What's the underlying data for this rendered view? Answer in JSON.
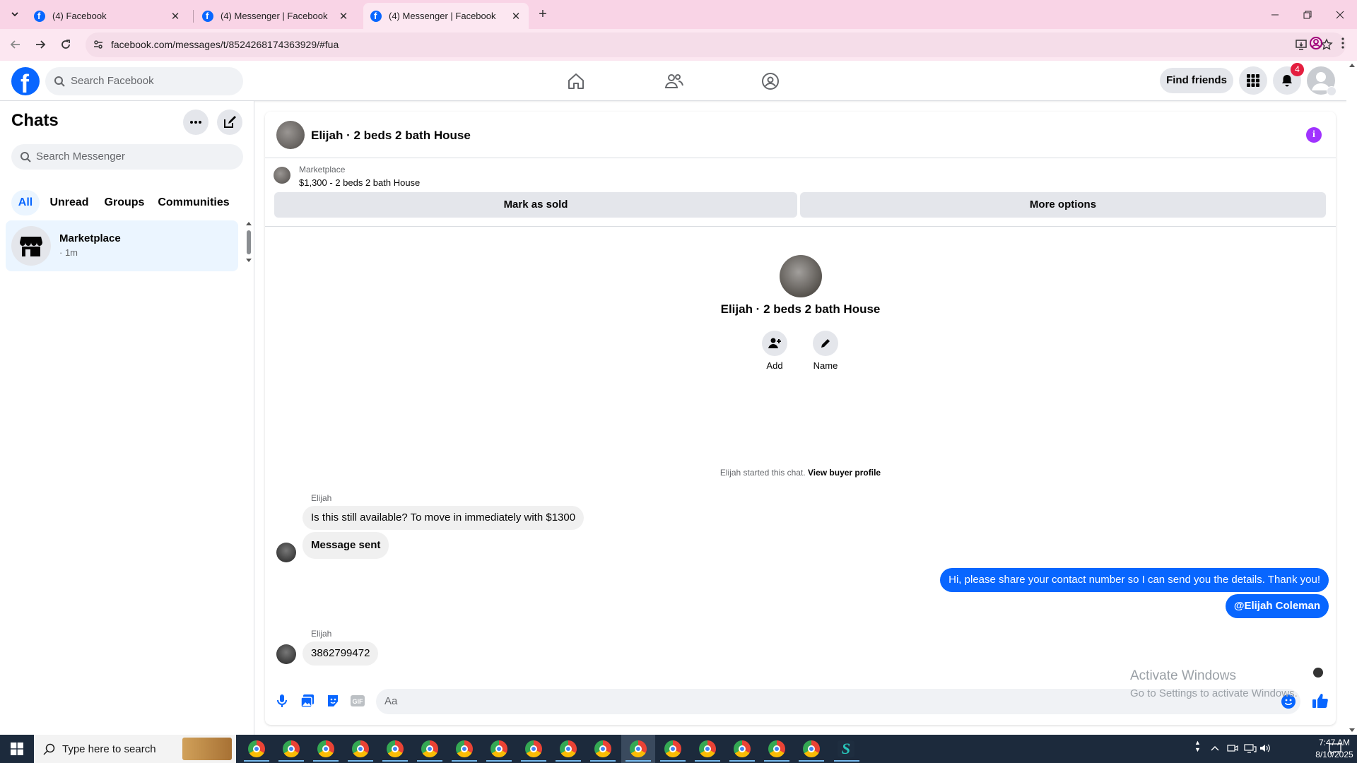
{
  "browser": {
    "tabs": [
      {
        "title": "(4) Facebook",
        "active": false
      },
      {
        "title": "(4) Messenger | Facebook",
        "active": false
      },
      {
        "title": "(4) Messenger | Facebook",
        "active": true
      }
    ],
    "url": "facebook.com/messages/t/8524268174363929/#fua"
  },
  "header": {
    "search_placeholder": "Search Facebook",
    "find_friends": "Find friends",
    "notification_count": "4"
  },
  "sidebar": {
    "title": "Chats",
    "search_placeholder": "Search Messenger",
    "filters": [
      "All",
      "Unread",
      "Groups",
      "Communities"
    ],
    "active_filter": "All",
    "conversations": [
      {
        "name": "Marketplace",
        "time": "· 1m"
      }
    ]
  },
  "chat": {
    "title": "Elijah · 2 beds 2 bath House",
    "listing": {
      "label": "Marketplace",
      "detail": "$1,300 - 2 beds 2 bath House",
      "mark_sold": "Mark as sold",
      "more_options": "More options"
    },
    "intro": {
      "name": "Elijah · 2 beds 2 bath House",
      "add_label": "Add",
      "name_label": "Name"
    },
    "started_text": "Elijah started this chat.",
    "view_buyer_profile": "View buyer profile",
    "messages": [
      {
        "sender": "Elijah",
        "text": "Is this still available? To move in immediately with $1300",
        "direction": "in"
      },
      {
        "sender": "",
        "text": "Message sent",
        "direction": "in"
      },
      {
        "sender": "",
        "text": "Hi, please share your contact number so I can send you the details. Thank you!",
        "direction": "out"
      },
      {
        "sender": "",
        "text": "@Elijah Coleman",
        "direction": "out"
      },
      {
        "sender": "Elijah",
        "text": "3862799472",
        "direction": "in"
      }
    ],
    "composer_placeholder": "Aa"
  },
  "watermark": {
    "line1": "Activate Windows",
    "line2": "Go to Settings to activate Windows."
  },
  "taskbar": {
    "search_placeholder": "Type here to search",
    "time": "7:47 AM",
    "date": "8/10/2025"
  },
  "colors": {
    "accent": "#0866ff",
    "tabstrip": "#f9d4e6",
    "info_icon": "#a033ff",
    "badge": "#e41e3f"
  }
}
